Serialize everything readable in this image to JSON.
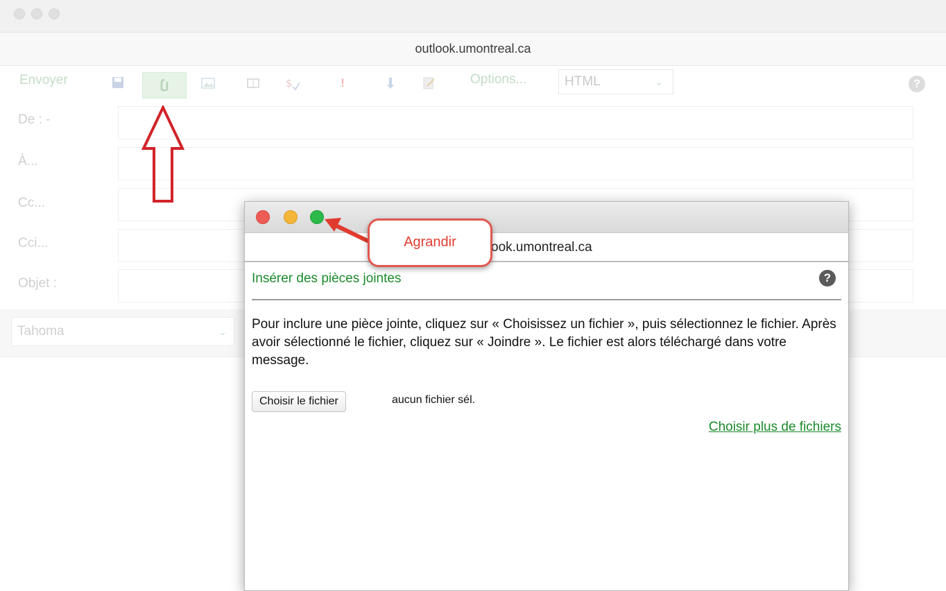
{
  "background_window": {
    "url": "outlook.umontreal.ca",
    "toolbar": {
      "send_label": "Envoyer",
      "options_label": "Options...",
      "format_value": "HTML"
    },
    "fields": {
      "from_label": "De : -",
      "to_label": "À...",
      "cc_label": "Cc...",
      "bcc_label": "Cci...",
      "subject_label": "Objet :"
    },
    "font_value": "Tahoma"
  },
  "dialog": {
    "url_partial": "ook.umontreal.ca",
    "heading": "Insérer des pièces jointes",
    "instructions": "Pour inclure une pièce jointe, cliquez sur « Choisissez un fichier », puis sélectionnez le fichier. Après avoir sélectionné le fichier, cliquez sur « Joindre ». Le fichier est alors téléchargé dans votre message.",
    "choose_file_button": "Choisir le fichier",
    "no_file_text": "aucun fichier sél.",
    "more_files_link": "Choisir plus de fichiers"
  },
  "annotation": {
    "callout_label": "Agrandir"
  },
  "colors": {
    "accent_green": "#1a8a2b",
    "annotation_red": "#e03b2f",
    "close": "#ee5d55",
    "minimize": "#f4b63a",
    "zoom": "#2db84a"
  },
  "icons": [
    "help-icon",
    "save-icon",
    "paperclip-icon",
    "image-icon",
    "book-icon",
    "spellcheck-icon",
    "priority-high-icon",
    "priority-low-icon",
    "signature-icon",
    "chevron-down-icon"
  ]
}
